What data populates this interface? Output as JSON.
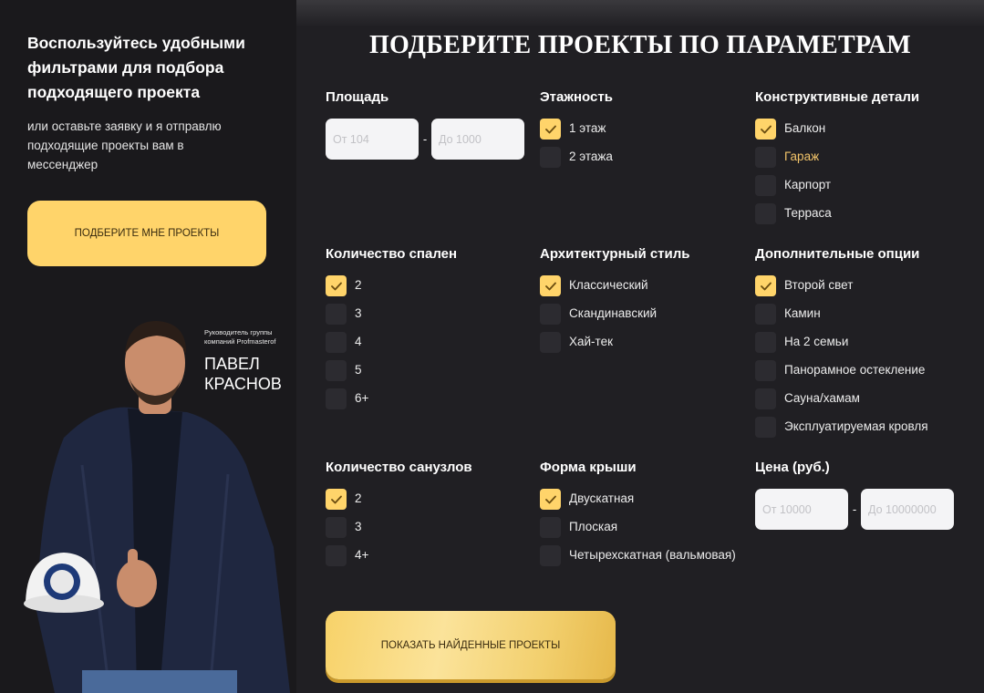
{
  "left": {
    "title": "Воспользуйтесь удобными фильтрами для подбора подходящего проекта",
    "subtitle": "или оставьте заявку и я отправлю подходящие проекты вам в мессенджер",
    "cta_label": "ПОДБЕРИТЕ МНЕ ПРОЕКТЫ",
    "person_role": "Руководитель группы компаний Profmasterof",
    "person_name_line1": "ПАВЕЛ",
    "person_name_line2": "КРАСНОВ"
  },
  "main": {
    "title": "ПОДБЕРИТЕ ПРОЕКТЫ ПО ПАРАМЕТРАМ",
    "area": {
      "title": "Площадь",
      "from_prefix": "От",
      "from_value": "104",
      "to_prefix": "До",
      "to_value": "1000"
    },
    "floors": {
      "title": "Этажность",
      "options": [
        {
          "label": "1 этаж",
          "checked": true
        },
        {
          "label": "2 этажа",
          "checked": false
        }
      ]
    },
    "details": {
      "title": "Конструктивные детали",
      "options": [
        {
          "label": "Балкон",
          "checked": true
        },
        {
          "label": "Гараж",
          "checked": false,
          "highlight": true
        },
        {
          "label": "Карпорт",
          "checked": false
        },
        {
          "label": "Терраса",
          "checked": false
        }
      ]
    },
    "bedrooms": {
      "title": "Количество спален",
      "options": [
        {
          "label": "2",
          "checked": true
        },
        {
          "label": "3",
          "checked": false
        },
        {
          "label": "4",
          "checked": false
        },
        {
          "label": "5",
          "checked": false
        },
        {
          "label": "6+",
          "checked": false
        }
      ]
    },
    "style": {
      "title": "Архитектурный стиль",
      "options": [
        {
          "label": "Классический",
          "checked": true
        },
        {
          "label": "Скандинавский",
          "checked": false
        },
        {
          "label": "Хай-тек",
          "checked": false
        }
      ]
    },
    "extra": {
      "title": "Дополнительные опции",
      "options": [
        {
          "label": "Второй свет",
          "checked": true
        },
        {
          "label": "Камин",
          "checked": false
        },
        {
          "label": "На 2 семьи",
          "checked": false
        },
        {
          "label": "Панорамное остекление",
          "checked": false
        },
        {
          "label": "Сауна/хамам",
          "checked": false
        },
        {
          "label": "Эксплуатируемая кровля",
          "checked": false
        }
      ]
    },
    "bathrooms": {
      "title": "Количество санузлов",
      "options": [
        {
          "label": "2",
          "checked": true
        },
        {
          "label": "3",
          "checked": false
        },
        {
          "label": "4+",
          "checked": false
        }
      ]
    },
    "roof": {
      "title": "Форма крыши",
      "options": [
        {
          "label": "Двускатная",
          "checked": true
        },
        {
          "label": "Плоская",
          "checked": false
        },
        {
          "label": "Четырехскатная (вальмовая)",
          "checked": false
        }
      ]
    },
    "price": {
      "title": "Цена (руб.)",
      "from_prefix": "От",
      "from_value": "10000",
      "to_prefix": "До",
      "to_value": "10000000"
    },
    "cta_label": "ПОКАЗАТЬ НАЙДЕННЫЕ ПРОЕКТЫ"
  },
  "colors": {
    "accent": "#ffd46a",
    "panel_left": "#1a191c",
    "panel_right": "#201f23",
    "checkbox_off": "#2c2b30"
  },
  "icons": {
    "checkmark": "check-icon"
  }
}
